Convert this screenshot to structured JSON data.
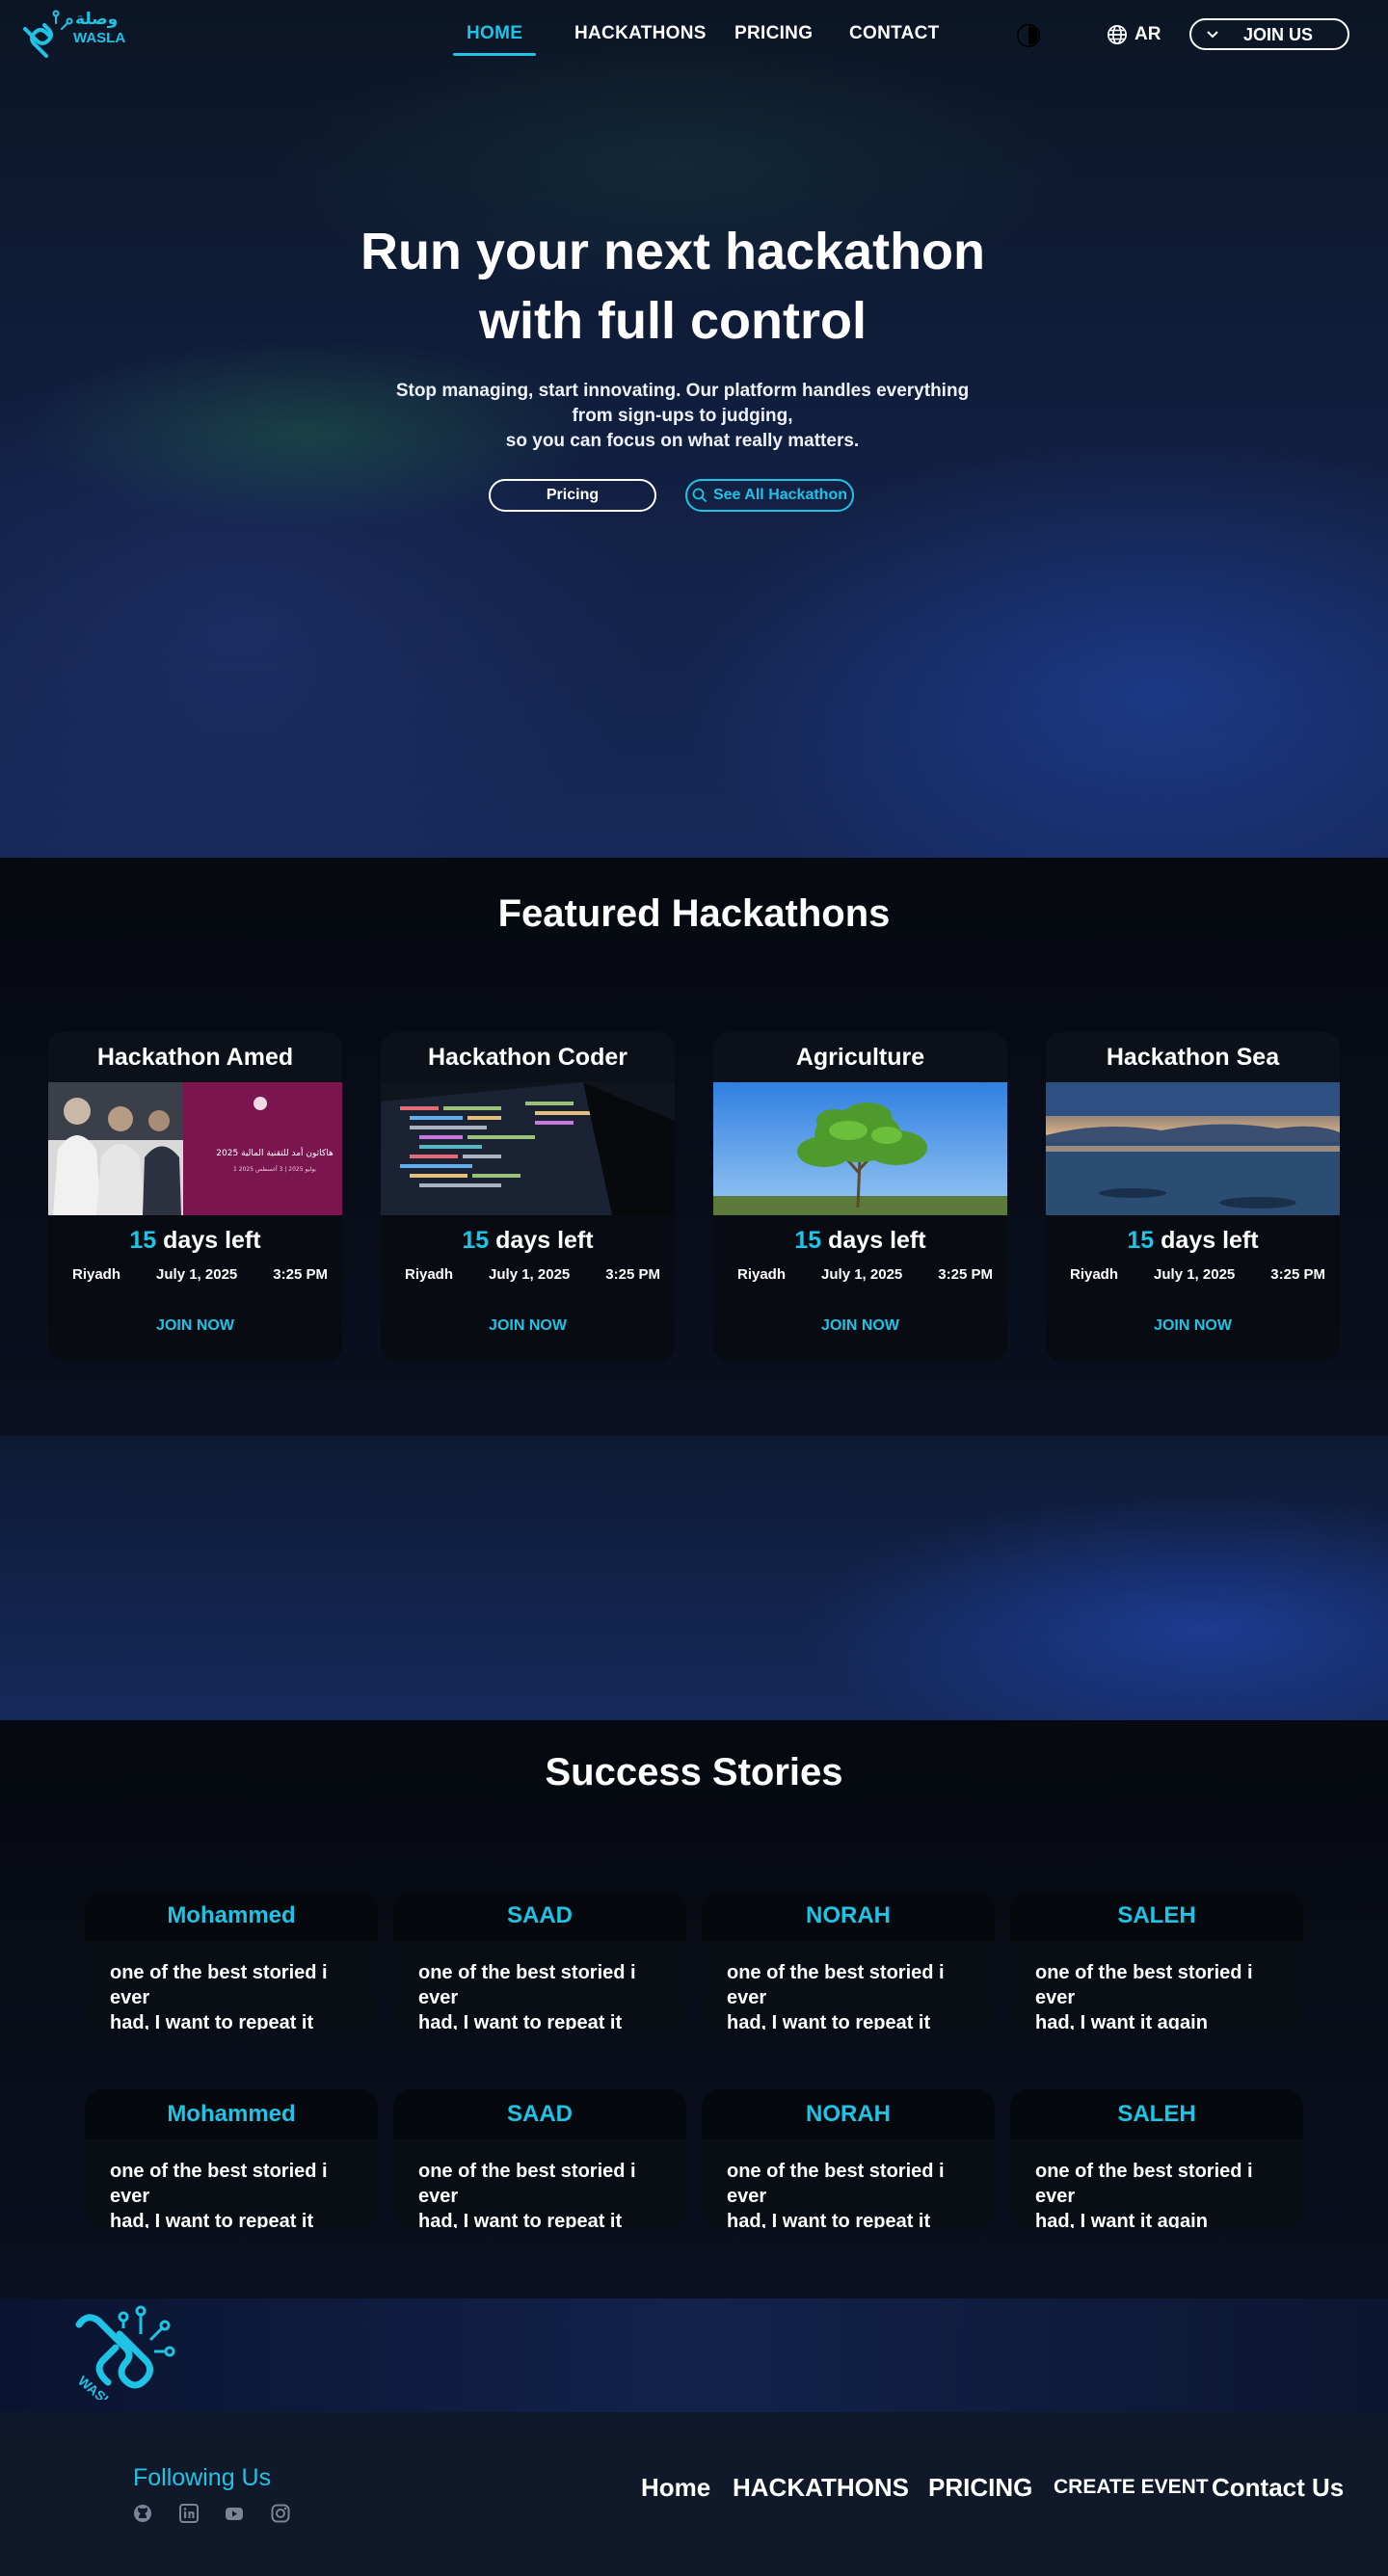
{
  "brand": {
    "name_ar": "وصلة",
    "name_en": "WASLA",
    "accent": "#1fc3e6"
  },
  "nav": {
    "links": [
      "HOME",
      "HACKATHONS",
      "PRICING",
      "CONTACT"
    ],
    "active": "HOME",
    "language": "AR",
    "join": "JOIN US"
  },
  "hero": {
    "title_line1": "Run your next hackathon",
    "title_line2": "with full control",
    "sub_line1": "Stop managing, start innovating. Our platform handles everything",
    "sub_line2": "from sign-ups to judging,",
    "sub_line3": "so you can focus on what really matters.",
    "btn_pricing": "Pricing",
    "btn_see_all": "See All Hackathon"
  },
  "featured": {
    "title": "Featured Hackathons",
    "cards": [
      {
        "title": "Hackathon Amed",
        "days": "15",
        "days_label": "days left",
        "city": "Riyadh",
        "date": "July 1, 2025",
        "time": "3:25 PM",
        "join": "JOIN NOW",
        "image": "event-banner-image",
        "banner_title": "هاكاثون أمد للتقنية المالية 2025",
        "banner_sub": "1 يوليو 2025 | 3 أغسطس 2025"
      },
      {
        "title": "Hackathon Coder",
        "days": "15",
        "days_label": "days left",
        "city": "Riyadh",
        "date": "July 1, 2025",
        "time": "3:25 PM",
        "join": "JOIN NOW",
        "image": "code-screen-image"
      },
      {
        "title": "Agriculture",
        "days": "15",
        "days_label": "days left",
        "city": "Riyadh",
        "date": "July 1, 2025",
        "time": "3:25 PM",
        "join": "JOIN NOW",
        "image": "tree-image"
      },
      {
        "title": "Hackathon Sea",
        "days": "15",
        "days_label": "days left",
        "city": "Riyadh",
        "date": "July 1, 2025",
        "time": "3:25 PM",
        "join": "JOIN NOW",
        "image": "sea-image"
      }
    ]
  },
  "stories": {
    "title": "Success Stories",
    "row1": [
      {
        "name": "Mohammed",
        "line1": "one of the best storied i ever",
        "line2": "had, I want to repeat it again"
      },
      {
        "name": "SAAD",
        "line1": "one of the best storied i ever",
        "line2": "had, I want to repeat it again"
      },
      {
        "name": "NORAH",
        "line1": "one of the best storied i ever",
        "line2": "had, I want to repeat it again"
      },
      {
        "name": "SALEH",
        "line1": "one of the best storied i ever",
        "line2": "had, I want it again"
      }
    ],
    "row2": [
      {
        "name": "Mohammed",
        "line1": "one of the best storied i ever",
        "line2": "had, I want to repeat it again"
      },
      {
        "name": "SAAD",
        "line1": "one of the best storied i ever",
        "line2": "had, I want to repeat it again"
      },
      {
        "name": "NORAH",
        "line1": "one of the best storied i ever",
        "line2": "had, I want to repeat it again"
      },
      {
        "name": "SALEH",
        "line1": "one of the best storied i ever",
        "line2": "had, I want it again"
      }
    ]
  },
  "footer": {
    "following": "Following Us",
    "social_icons": [
      "github-icon",
      "linkedin-icon",
      "youtube-icon",
      "instagram-icon"
    ],
    "links": [
      "Home",
      "HACKATHONS",
      "PRICING",
      "CREATE EVENT",
      "Contact Us"
    ]
  }
}
